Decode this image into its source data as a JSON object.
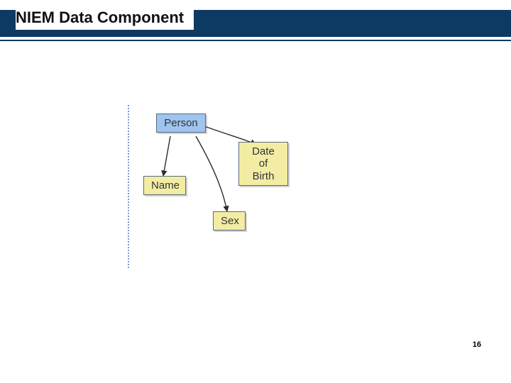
{
  "slide": {
    "title": "NIEM Data Component",
    "page_number": "16"
  },
  "diagram": {
    "parent": {
      "label": "Person"
    },
    "children": [
      {
        "label": "Name"
      },
      {
        "label": "Date of\nBirth"
      },
      {
        "label": "Sex"
      }
    ]
  }
}
